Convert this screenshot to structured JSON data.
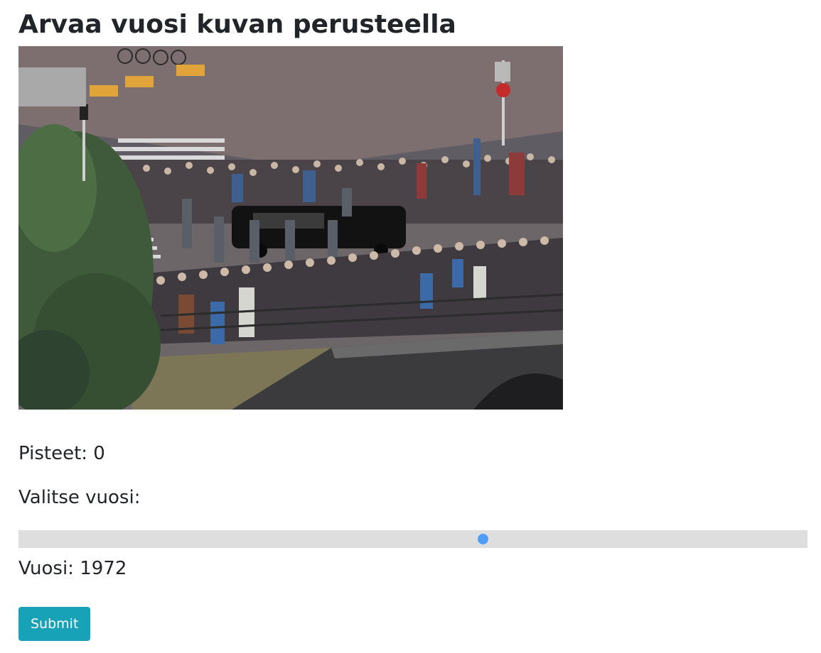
{
  "page": {
    "title": "Arvaa vuosi kuvan perusteella"
  },
  "photo": {
    "alt": "Valokuva"
  },
  "score": {
    "label": "Pisteet:",
    "value": "0",
    "text": "Pisteet: 0"
  },
  "year_picker": {
    "label": "Valitse vuosi:",
    "selected_year": 1972,
    "selected_fraction": 0.589,
    "text": "Vuosi: 1972"
  },
  "actions": {
    "submit_label": "Submit"
  },
  "colors": {
    "accent": "#17a2b8",
    "slider_thumb": "#4f9cf9",
    "slider_track": "#dedede",
    "text": "#212529"
  }
}
